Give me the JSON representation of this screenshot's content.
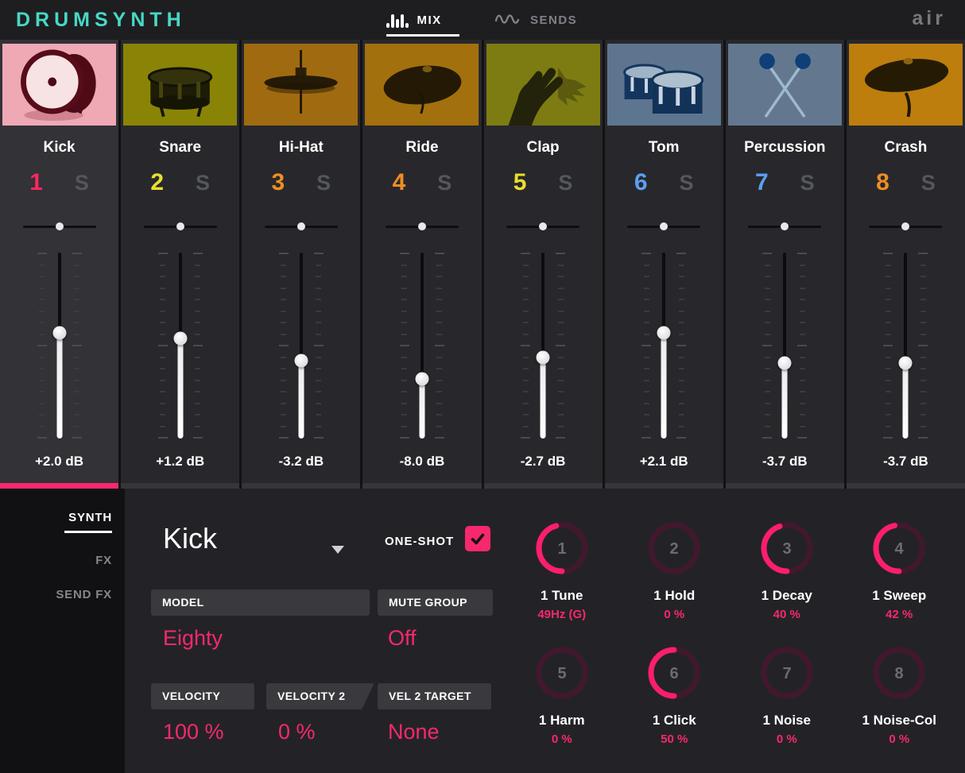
{
  "header": {
    "logo": "DRUMSYNTH",
    "tabs": [
      {
        "label": "MIX",
        "active": true
      },
      {
        "label": "SENDS",
        "active": false
      }
    ],
    "brand": "air"
  },
  "colors": {
    "accent": "#f8286d",
    "teal": "#47d8c3",
    "solo_gray": "#54575c",
    "knob_track": "#42182f"
  },
  "channels": [
    {
      "name": "Kick",
      "number": "1",
      "number_color": "#f8295f",
      "solo_label": "S",
      "db": "+2.0 dB",
      "fader_pos": 0.43,
      "pan_pos": 0.5,
      "selected": true,
      "art": "kick-drum",
      "art_bg": "#efa9b5"
    },
    {
      "name": "Snare",
      "number": "2",
      "number_color": "#e8df2e",
      "solo_label": "S",
      "db": "+1.2 dB",
      "fader_pos": 0.46,
      "pan_pos": 0.5,
      "selected": false,
      "art": "snare-drum",
      "art_bg": "#8a8406"
    },
    {
      "name": "Hi-Hat",
      "number": "3",
      "number_color": "#ef8d24",
      "solo_label": "S",
      "db": "-3.2 dB",
      "fader_pos": 0.58,
      "pan_pos": 0.5,
      "selected": false,
      "art": "hi-hat-cymbal",
      "art_bg": "#a06b10"
    },
    {
      "name": "Ride",
      "number": "4",
      "number_color": "#ef8d24",
      "solo_label": "S",
      "db": "-8.0 dB",
      "fader_pos": 0.68,
      "pan_pos": 0.5,
      "selected": false,
      "art": "ride-cymbal",
      "art_bg": "#a3700e"
    },
    {
      "name": "Clap",
      "number": "5",
      "number_color": "#e8df2e",
      "solo_label": "S",
      "db": "-2.7 dB",
      "fader_pos": 0.565,
      "pan_pos": 0.5,
      "selected": false,
      "art": "clapping-hands",
      "art_bg": "#7d7c12"
    },
    {
      "name": "Tom",
      "number": "6",
      "number_color": "#5aa0f2",
      "solo_label": "S",
      "db": "+2.1 dB",
      "fader_pos": 0.43,
      "pan_pos": 0.5,
      "selected": false,
      "art": "tom-drums",
      "art_bg": "#5e7590"
    },
    {
      "name": "Percussion",
      "number": "7",
      "number_color": "#5aa0f2",
      "solo_label": "S",
      "db": "-3.7 dB",
      "fader_pos": 0.595,
      "pan_pos": 0.5,
      "selected": false,
      "art": "crossed-mallets",
      "art_bg": "#63788f"
    },
    {
      "name": "Crash",
      "number": "8",
      "number_color": "#ef8d24",
      "solo_label": "S",
      "db": "-3.7 dB",
      "fader_pos": 0.595,
      "pan_pos": 0.5,
      "selected": false,
      "art": "crash-cymbal",
      "art_bg": "#bd7e0e"
    }
  ],
  "side_tabs": [
    {
      "label": "SYNTH",
      "active": true
    },
    {
      "label": "FX",
      "active": false
    },
    {
      "label": "SEND FX",
      "active": false
    }
  ],
  "editor": {
    "pad_name": "Kick",
    "one_shot": {
      "label": "ONE-SHOT",
      "checked": true
    },
    "fields": [
      {
        "label": "MODEL",
        "value": "Eighty"
      },
      {
        "label": "MUTE GROUP",
        "value": "Off"
      },
      {
        "label": "VELOCITY",
        "value": "100 %"
      },
      {
        "label": "VELOCITY 2",
        "value": "0 %"
      },
      {
        "label": "VEL 2 TARGET",
        "value": "None"
      }
    ],
    "knobs": [
      {
        "number": "1",
        "label": "1 Tune",
        "value": "49Hz (G)",
        "fraction": 0.46
      },
      {
        "number": "2",
        "label": "1 Hold",
        "value": "0 %",
        "fraction": 0
      },
      {
        "number": "3",
        "label": "1 Decay",
        "value": "40 %",
        "fraction": 0.45
      },
      {
        "number": "4",
        "label": "1 Sweep",
        "value": "42 %",
        "fraction": 0.47
      },
      {
        "number": "5",
        "label": "1 Harm",
        "value": "0 %",
        "fraction": 0
      },
      {
        "number": "6",
        "label": "1 Click",
        "value": "50 %",
        "fraction": 0.5
      },
      {
        "number": "7",
        "label": "1 Noise",
        "value": "0 %",
        "fraction": 0
      },
      {
        "number": "8",
        "label": "1 Noise-Col",
        "value": "0 %",
        "fraction": 0
      }
    ]
  }
}
